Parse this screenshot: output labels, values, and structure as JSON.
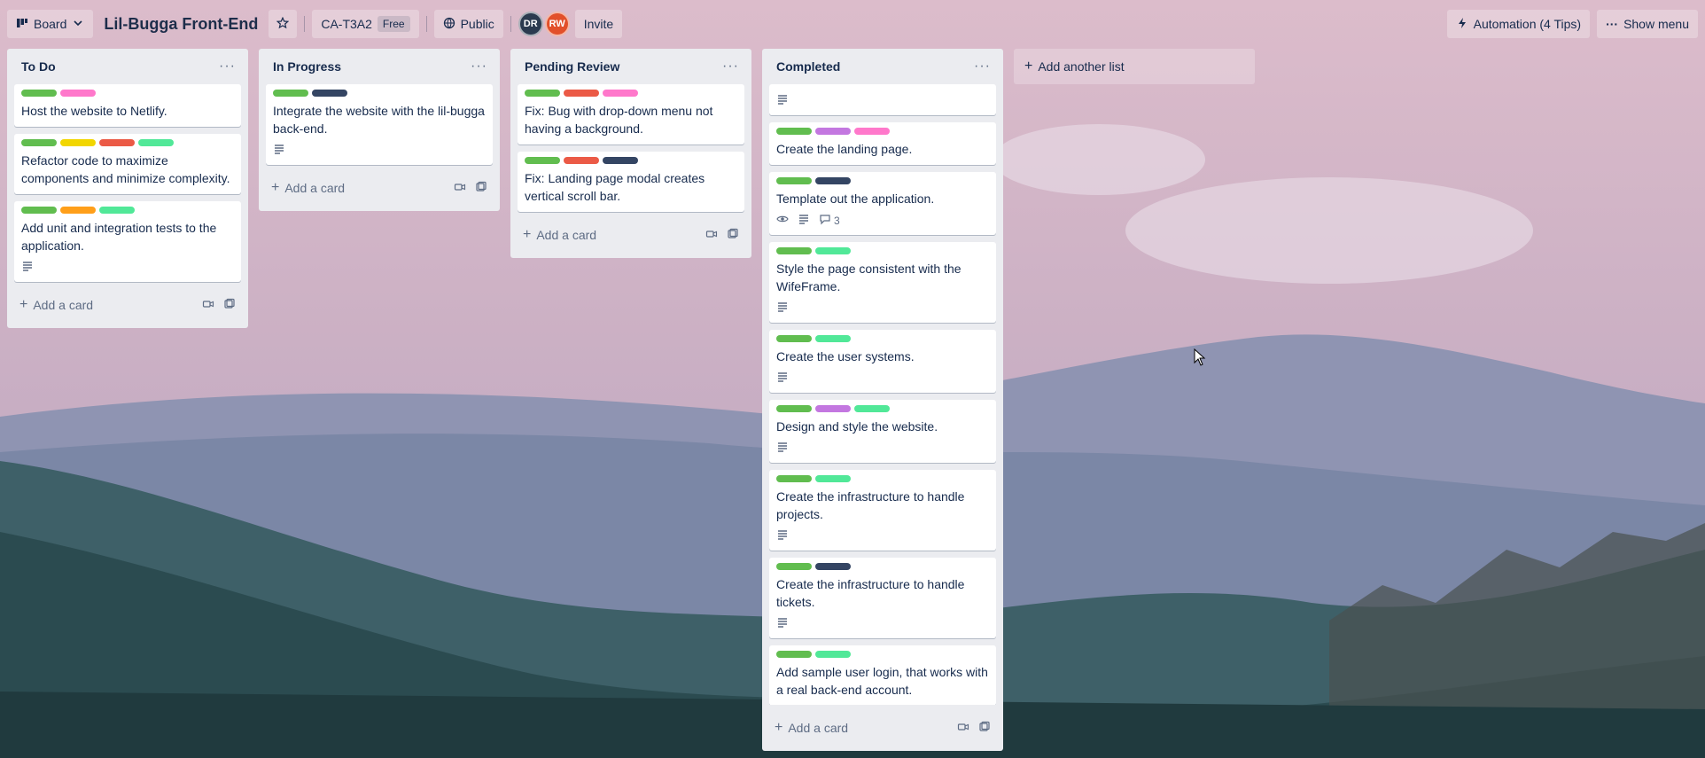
{
  "topbar": {
    "board_button": "Board",
    "title": "Lil-Bugga Front-End",
    "workspace": "CA-T3A2",
    "workspace_badge": "Free",
    "visibility": "Public",
    "avatars": [
      {
        "initials": "DR",
        "color": "#2b3a4f"
      },
      {
        "initials": "RW",
        "color": "#e2502a"
      }
    ],
    "invite": "Invite",
    "automation": "Automation (4 Tips)",
    "show_menu": "Show menu"
  },
  "labels_colors": {
    "green": "#61bd4f",
    "pink": "#ff78cb",
    "yellow": "#f2d600",
    "red": "#eb5a46",
    "lime": "#51e898",
    "orange": "#ff9f1a",
    "navy": "#344563",
    "purple": "#c377e0"
  },
  "lists": [
    {
      "title": "To Do",
      "add_card": "Add a card",
      "cards": [
        {
          "labels": [
            "green",
            "pink"
          ],
          "text": "Host the website to Netlify.",
          "desc": false
        },
        {
          "labels": [
            "green",
            "yellow",
            "red",
            "lime"
          ],
          "text": "Refactor code to maximize components and minimize complexity.",
          "desc": false
        },
        {
          "labels": [
            "green",
            "orange",
            "lime"
          ],
          "text": "Add unit and integration tests to the application.",
          "desc": true
        }
      ]
    },
    {
      "title": "In Progress",
      "add_card": "Add a card",
      "cards": [
        {
          "labels": [
            "green",
            "navy"
          ],
          "text": "Integrate the website with the lil-bugga back-end.",
          "desc": true
        }
      ]
    },
    {
      "title": "Pending Review",
      "add_card": "Add a card",
      "cards": [
        {
          "labels": [
            "green",
            "red",
            "pink"
          ],
          "text": "Fix: Bug with drop-down menu not having a background.",
          "desc": false
        },
        {
          "labels": [
            "green",
            "red",
            "navy"
          ],
          "text": "Fix: Landing page modal creates vertical scroll bar.",
          "desc": false
        }
      ]
    },
    {
      "title": "Completed",
      "add_card": "Add a card",
      "cards": [
        {
          "labels": [],
          "text": "",
          "desc": true,
          "partial": true
        },
        {
          "labels": [
            "green",
            "purple",
            "pink"
          ],
          "text": "Create the landing page.",
          "desc": false
        },
        {
          "labels": [
            "green",
            "navy"
          ],
          "text": "Template out the application.",
          "desc": true,
          "watch": true,
          "comments": "3"
        },
        {
          "labels": [
            "green",
            "lime"
          ],
          "text": "Style the page consistent with the WifeFrame.",
          "desc": true
        },
        {
          "labels": [
            "green",
            "lime"
          ],
          "text": "Create the user systems.",
          "desc": true
        },
        {
          "labels": [
            "green",
            "purple",
            "lime"
          ],
          "text": "Design and style the website.",
          "desc": true
        },
        {
          "labels": [
            "green",
            "lime"
          ],
          "text": "Create the infrastructure to handle projects.",
          "desc": true
        },
        {
          "labels": [
            "green",
            "navy"
          ],
          "text": "Create the infrastructure to handle tickets.",
          "desc": true
        },
        {
          "labels": [
            "green",
            "lime"
          ],
          "text": "Add sample user login, that works with a real back-end account.",
          "desc": false
        }
      ]
    }
  ],
  "add_list": "Add another list"
}
